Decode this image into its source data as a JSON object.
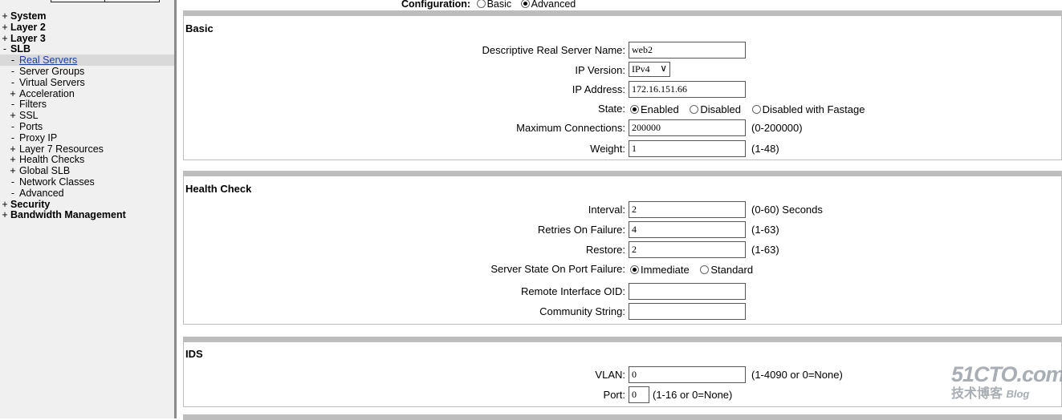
{
  "sidebar": {
    "items": [
      {
        "sym": "+",
        "label": "System",
        "level": 0
      },
      {
        "sym": "+",
        "label": "Layer 2",
        "level": 0
      },
      {
        "sym": "+",
        "label": "Layer 3",
        "level": 0
      },
      {
        "sym": "-",
        "label": "SLB",
        "level": 0
      },
      {
        "sym": "-",
        "label": "Real Servers",
        "level": 1,
        "active": true
      },
      {
        "sym": "-",
        "label": "Server Groups",
        "level": 1
      },
      {
        "sym": "-",
        "label": "Virtual Servers",
        "level": 1
      },
      {
        "sym": "+",
        "label": "Acceleration",
        "level": 1
      },
      {
        "sym": "-",
        "label": "Filters",
        "level": 1
      },
      {
        "sym": "+",
        "label": "SSL",
        "level": 1
      },
      {
        "sym": "-",
        "label": "Ports",
        "level": 1
      },
      {
        "sym": "-",
        "label": "Proxy IP",
        "level": 1
      },
      {
        "sym": "+",
        "label": "Layer 7 Resources",
        "level": 1
      },
      {
        "sym": "+",
        "label": "Health Checks",
        "level": 1
      },
      {
        "sym": "+",
        "label": "Global SLB",
        "level": 1
      },
      {
        "sym": "-",
        "label": "Network Classes",
        "level": 1
      },
      {
        "sym": "-",
        "label": "Advanced",
        "level": 1
      },
      {
        "sym": "+",
        "label": "Security",
        "level": 0
      },
      {
        "sym": "+",
        "label": "Bandwidth Management",
        "level": 0
      }
    ]
  },
  "config": {
    "label": "Configuration:",
    "options": [
      "Basic",
      "Advanced"
    ],
    "selected": "Advanced"
  },
  "basic": {
    "title": "Basic",
    "name_label": "Descriptive Real Server Name:",
    "name_value": "web2",
    "ipver_label": "IP Version:",
    "ipver_value": "IPv4",
    "ip_label": "IP Address:",
    "ip_value": "172.16.151.66",
    "state_label": "State:",
    "state_options": [
      "Enabled",
      "Disabled",
      "Disabled with Fastage"
    ],
    "state_selected": "Enabled",
    "maxconn_label": "Maximum Connections:",
    "maxconn_value": "200000",
    "maxconn_hint": "(0-200000)",
    "weight_label": "Weight:",
    "weight_value": "1",
    "weight_hint": "(1-48)"
  },
  "health": {
    "title": "Health Check",
    "interval_label": "Interval:",
    "interval_value": "2",
    "interval_hint": "(0-60) Seconds",
    "retries_label": "Retries On Failure:",
    "retries_value": "4",
    "retries_hint": "(1-63)",
    "restore_label": "Restore:",
    "restore_value": "2",
    "restore_hint": "(1-63)",
    "portfail_label": "Server State On Port Failure:",
    "portfail_options": [
      "Immediate",
      "Standard"
    ],
    "portfail_selected": "Immediate",
    "oid_label": "Remote Interface OID:",
    "oid_value": "",
    "community_label": "Community String:",
    "community_value": ""
  },
  "ids": {
    "title": "IDS",
    "vlan_label": "VLAN:",
    "vlan_value": "0",
    "vlan_hint": "(1-4090 or 0=None)",
    "port_label": "Port:",
    "port_value": "0",
    "port_hint": "(1-16 or 0=None)"
  },
  "watermark": {
    "line1": "51CTO.com",
    "line2": "技术博客",
    "line3": "Blog"
  }
}
